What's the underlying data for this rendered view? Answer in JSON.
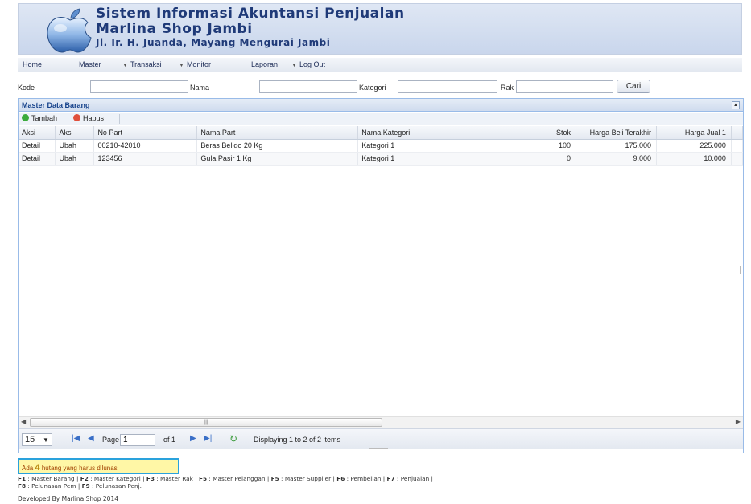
{
  "header": {
    "line1": "Sistem Informasi Akuntansi Penjualan",
    "line2": "Marlina Shop Jambi",
    "line3": "Jl. Ir. H. Juanda, Mayang Mengurai Jambi"
  },
  "menu": {
    "home": "Home",
    "master": "Master",
    "transaksi": "Transaksi",
    "monitor": "Monitor",
    "laporan": "Laporan",
    "logout": "Log Out"
  },
  "search": {
    "kode_label": "Kode",
    "nama_label": "Nama",
    "kategori_label": "Kategori",
    "rak_label": "Rak",
    "kode_value": "",
    "nama_value": "",
    "kategori_value": "",
    "rak_value": "",
    "cari_label": "Cari"
  },
  "grid": {
    "title": "Master Data Barang",
    "tambah_label": "Tambah",
    "hapus_label": "Hapus",
    "columns": [
      "Aksi",
      "Aksi",
      "No Part",
      "Nama Part",
      "Nama Kategori",
      "Stok",
      "Harga Beli Terakhir",
      "Harga Jual 1"
    ],
    "rows": [
      {
        "aksi1": "Detail",
        "aksi2": "Ubah",
        "no_part": "00210-42010",
        "nama_part": "Beras Belido 20 Kg",
        "kategori": "Kategori 1",
        "stok": "100",
        "harga_beli": "175.000",
        "harga_jual": "225.000"
      },
      {
        "aksi1": "Detail",
        "aksi2": "Ubah",
        "no_part": "123456",
        "nama_part": "Gula Pasir 1 Kg",
        "kategori": "Kategori 1",
        "stok": "0",
        "harga_beli": "9.000",
        "harga_jual": "10.000"
      }
    ]
  },
  "pager": {
    "page_size": "15",
    "page_label": "Page",
    "page_value": "1",
    "of_label": "of 1",
    "display_text": "Displaying 1 to 2 of 2 items"
  },
  "notice": {
    "prefix": "Ada",
    "count": "4",
    "suffix": "hutang yang harus dilunasi"
  },
  "shortcuts": [
    {
      "key": "F1",
      "label": "Master Barang"
    },
    {
      "key": "F2",
      "label": "Master Kategori"
    },
    {
      "key": "F3",
      "label": "Master Rak"
    },
    {
      "key": "F5",
      "label": "Master Pelanggan"
    },
    {
      "key": "F5",
      "label": "Master Supplier"
    },
    {
      "key": "F6",
      "label": "Pembelian"
    },
    {
      "key": "F7",
      "label": "Penjualan"
    },
    {
      "key": "F8",
      "label": "Pelunasan Pem"
    },
    {
      "key": "F9",
      "label": "Pelunasan Penj."
    }
  ],
  "footer": {
    "developed": "Developed By Marlina Shop 2014"
  },
  "colors": {
    "title": "#1f3a78",
    "tambah": "#3cab3c",
    "hapus": "#e0503c",
    "notice_border": "#2aa2dc",
    "notice_bg": "#fff7a6"
  },
  "icons": [
    "apple-logo-icon",
    "add-icon",
    "delete-icon",
    "first-page-icon",
    "prev-page-icon",
    "next-page-icon",
    "last-page-icon",
    "refresh-icon",
    "page-size-dropdown-icon"
  ]
}
